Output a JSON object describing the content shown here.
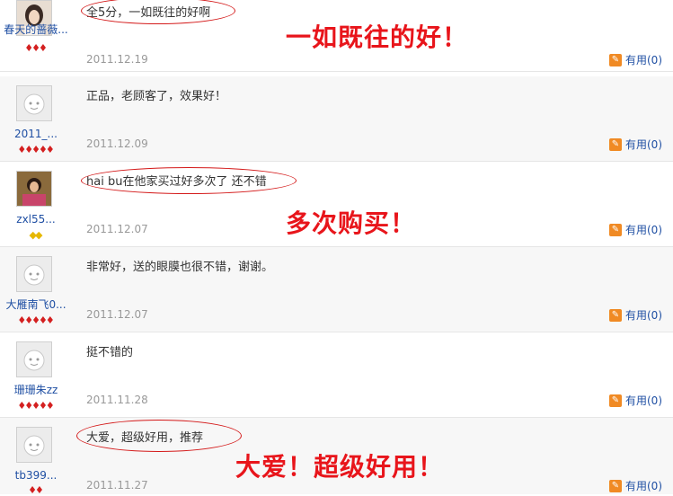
{
  "reviews": [
    {
      "username": "春天的蔷薇...",
      "rank_color": "red",
      "rank_count": 3,
      "content": "全5分，一如既往的好啊",
      "date": "2011.12.19",
      "useful_label": "有用(0)",
      "avatar": "photo-avatar"
    },
    {
      "username": "2011_...",
      "rank_color": "red",
      "rank_count": 5,
      "content": "正品，老顾客了，效果好！",
      "date": "2011.12.09",
      "useful_label": "有用(0)",
      "avatar": "default-avatar"
    },
    {
      "username": "zxl55...",
      "rank_color": "yellow",
      "rank_count": 2,
      "content": "hai bu在他家买过好多次了 还不错",
      "date": "2011.12.07",
      "useful_label": "有用(0)",
      "avatar": "photo-avatar"
    },
    {
      "username": "大雁南飞0...",
      "rank_color": "red",
      "rank_count": 5,
      "content": "非常好，送的眼膜也很不错，谢谢。",
      "date": "2011.12.07",
      "useful_label": "有用(0)",
      "avatar": "default-avatar"
    },
    {
      "username": "珊珊朱zz",
      "rank_color": "red",
      "rank_count": 5,
      "content": "挺不错的",
      "date": "2011.11.28",
      "useful_label": "有用(0)",
      "avatar": "default-avatar"
    },
    {
      "username": "tb399...",
      "rank_color": "red",
      "rank_count": 2,
      "content": "大爱，超级好用，推荐",
      "date": "2011.11.27",
      "useful_label": "有用(0)",
      "avatar": "default-avatar"
    }
  ],
  "annotations": [
    "一如既往的好！",
    "多次购买！",
    "大爱！超级好用！"
  ],
  "colors": {
    "annotation": "#e8151b",
    "username": "#1f4fa3",
    "date": "#999999",
    "useful_icon": "#f08a24"
  }
}
